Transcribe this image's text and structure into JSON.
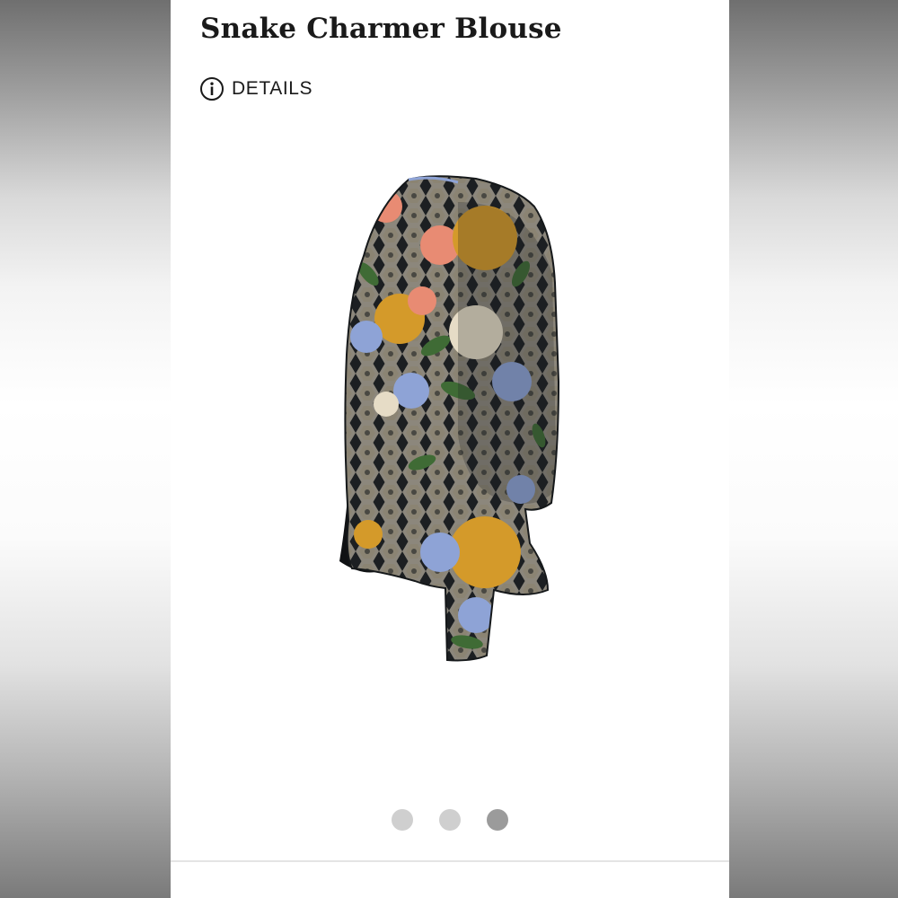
{
  "product": {
    "title": "Snake Charmer Blouse",
    "details_label": "DETAILS",
    "image_alt": "Snake Charmer Blouse product photo — sheer black chiffon with snakeskin and floral print"
  },
  "icons": {
    "details": "info-circle-icon"
  },
  "carousel": {
    "slides": 3,
    "active_index": 2
  },
  "colors": {
    "text": "#1a1a1a",
    "dot_inactive": "#cfcfcf",
    "dot_active": "#9b9b9b",
    "print_black": "#1c1f22",
    "print_mustard": "#d49a2a",
    "print_coral": "#e88b73",
    "print_blue": "#8ea3d6",
    "print_cream": "#e6dcc6",
    "print_green": "#3f6b35"
  }
}
